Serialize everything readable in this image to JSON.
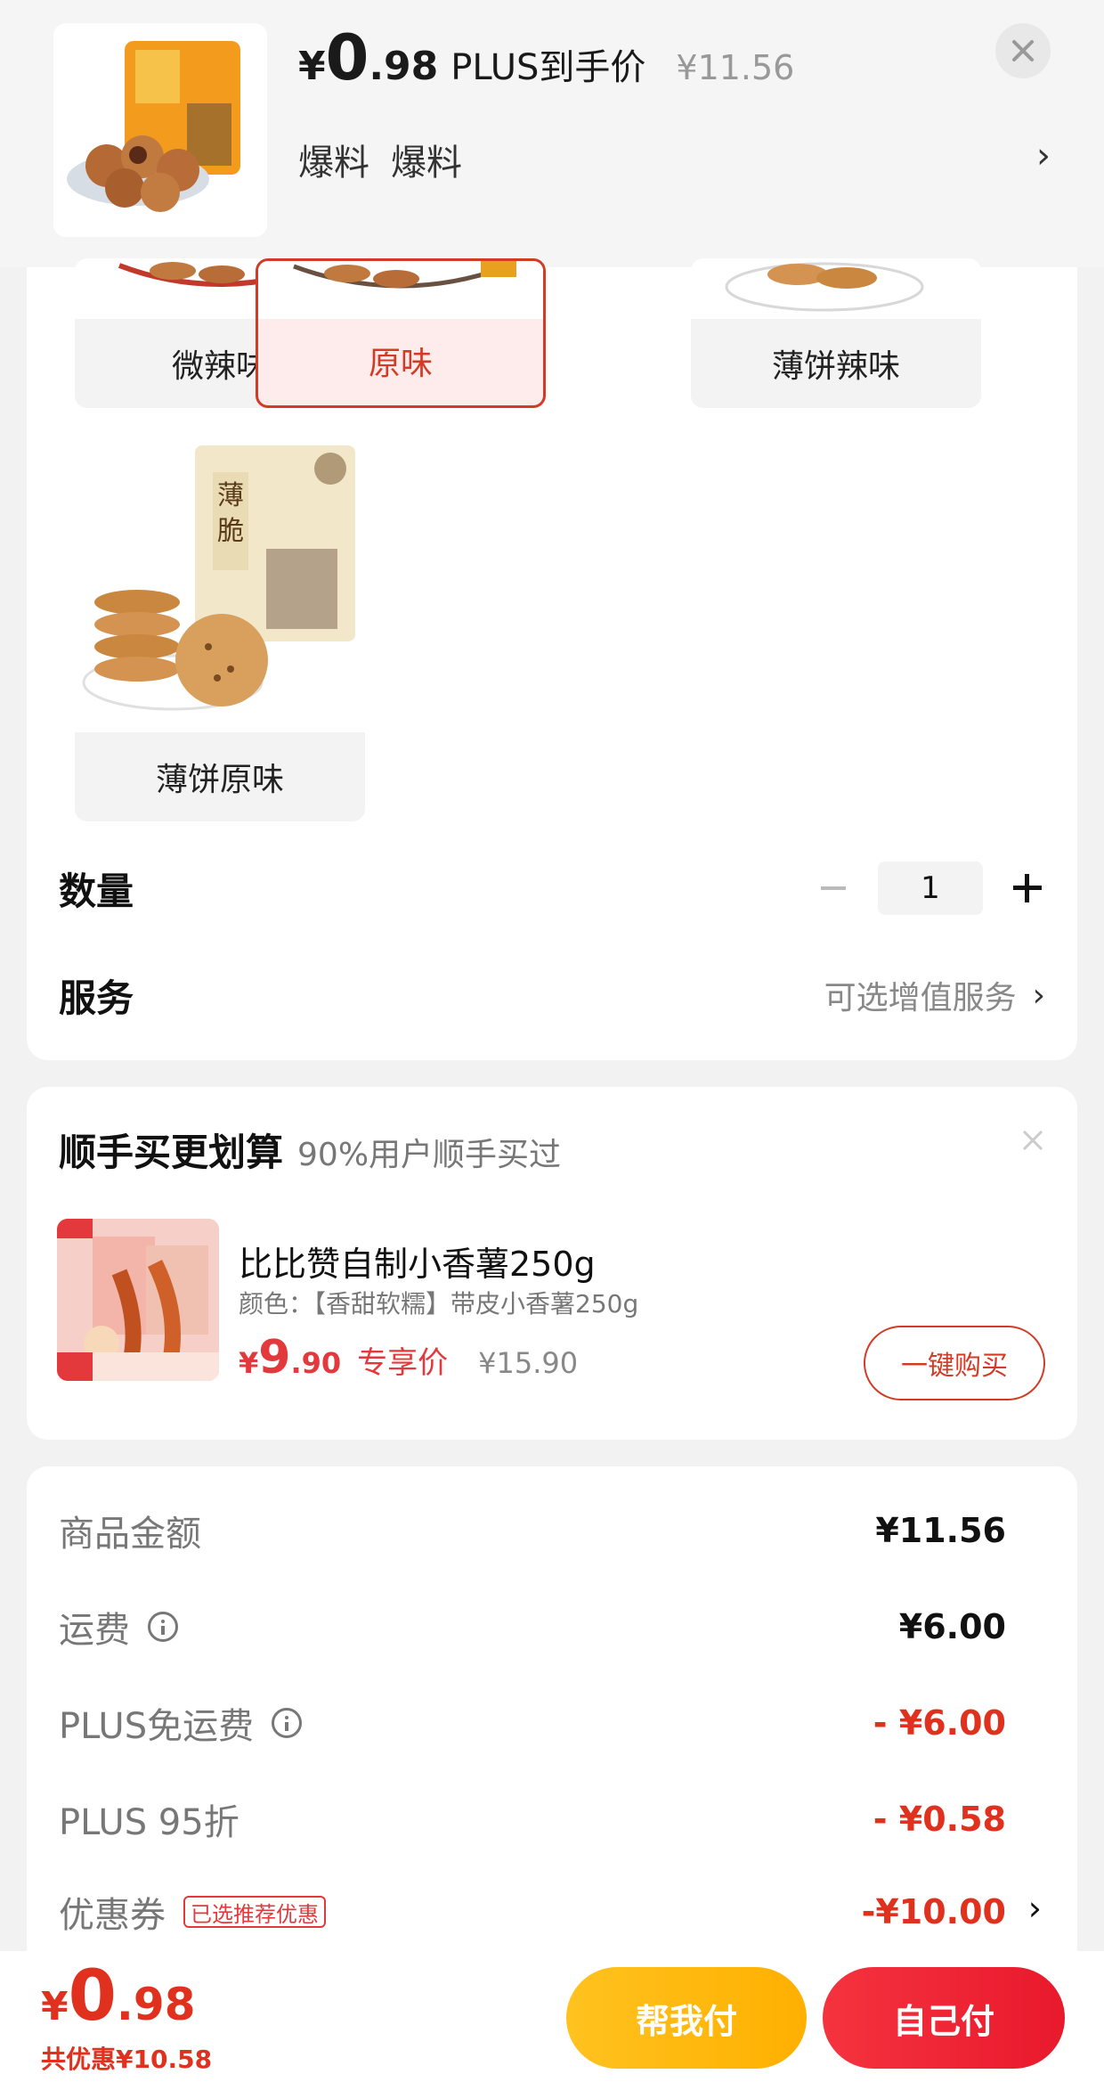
{
  "header": {
    "price_currency": "¥",
    "price_int": "0",
    "price_dec": ".98",
    "price_tag": "PLUS到手价",
    "original_price": "¥11.56",
    "tags": [
      "爆料",
      "爆料"
    ],
    "close_icon": "close-icon",
    "chevron_icon": "chevron-right-icon"
  },
  "variants": [
    {
      "label": "微辣味",
      "selected": false
    },
    {
      "label": "原味",
      "selected": true
    },
    {
      "label": "薄饼辣味",
      "selected": false
    },
    {
      "label": "薄饼原味",
      "selected": false
    }
  ],
  "quantity": {
    "label": "数量",
    "value": "1"
  },
  "service": {
    "label": "服务",
    "value": "可选增值服务"
  },
  "recommend": {
    "title": "顺手买更划算",
    "subtitle": "90%用户顺手买过",
    "product": {
      "name": "比比赞自制小香薯250g",
      "spec": "颜色：【香甜软糯】带皮小香薯250g",
      "price_currency": "¥",
      "price_int": "9",
      "price_dec": ".90",
      "price_tag": "专享价",
      "original_price": "¥15.90",
      "buy_label": "一键购买"
    }
  },
  "summary": {
    "rows": [
      {
        "label": "商品金额",
        "value": "¥11.56",
        "red": false,
        "info": false
      },
      {
        "label": "运费",
        "value": "¥6.00",
        "red": false,
        "info": true
      },
      {
        "label": "PLUS免运费",
        "value": "- ¥6.00",
        "red": true,
        "info": true
      },
      {
        "label": "PLUS 95折",
        "value": "- ¥0.58",
        "red": true,
        "info": false
      },
      {
        "label": "优惠券",
        "value": "-¥10.00",
        "red": true,
        "info": false,
        "badge": "已选推荐优惠"
      }
    ]
  },
  "bottom": {
    "currency": "¥",
    "total_int": "0",
    "total_dec": ".98",
    "savings": "共优惠¥10.58",
    "help_pay": "帮我付",
    "self_pay": "自己付"
  },
  "colors": {
    "accent_red": "#e0301e",
    "selected_border": "#d23c27",
    "yellow_button": "#ffb000",
    "red_button": "#f5333f"
  }
}
